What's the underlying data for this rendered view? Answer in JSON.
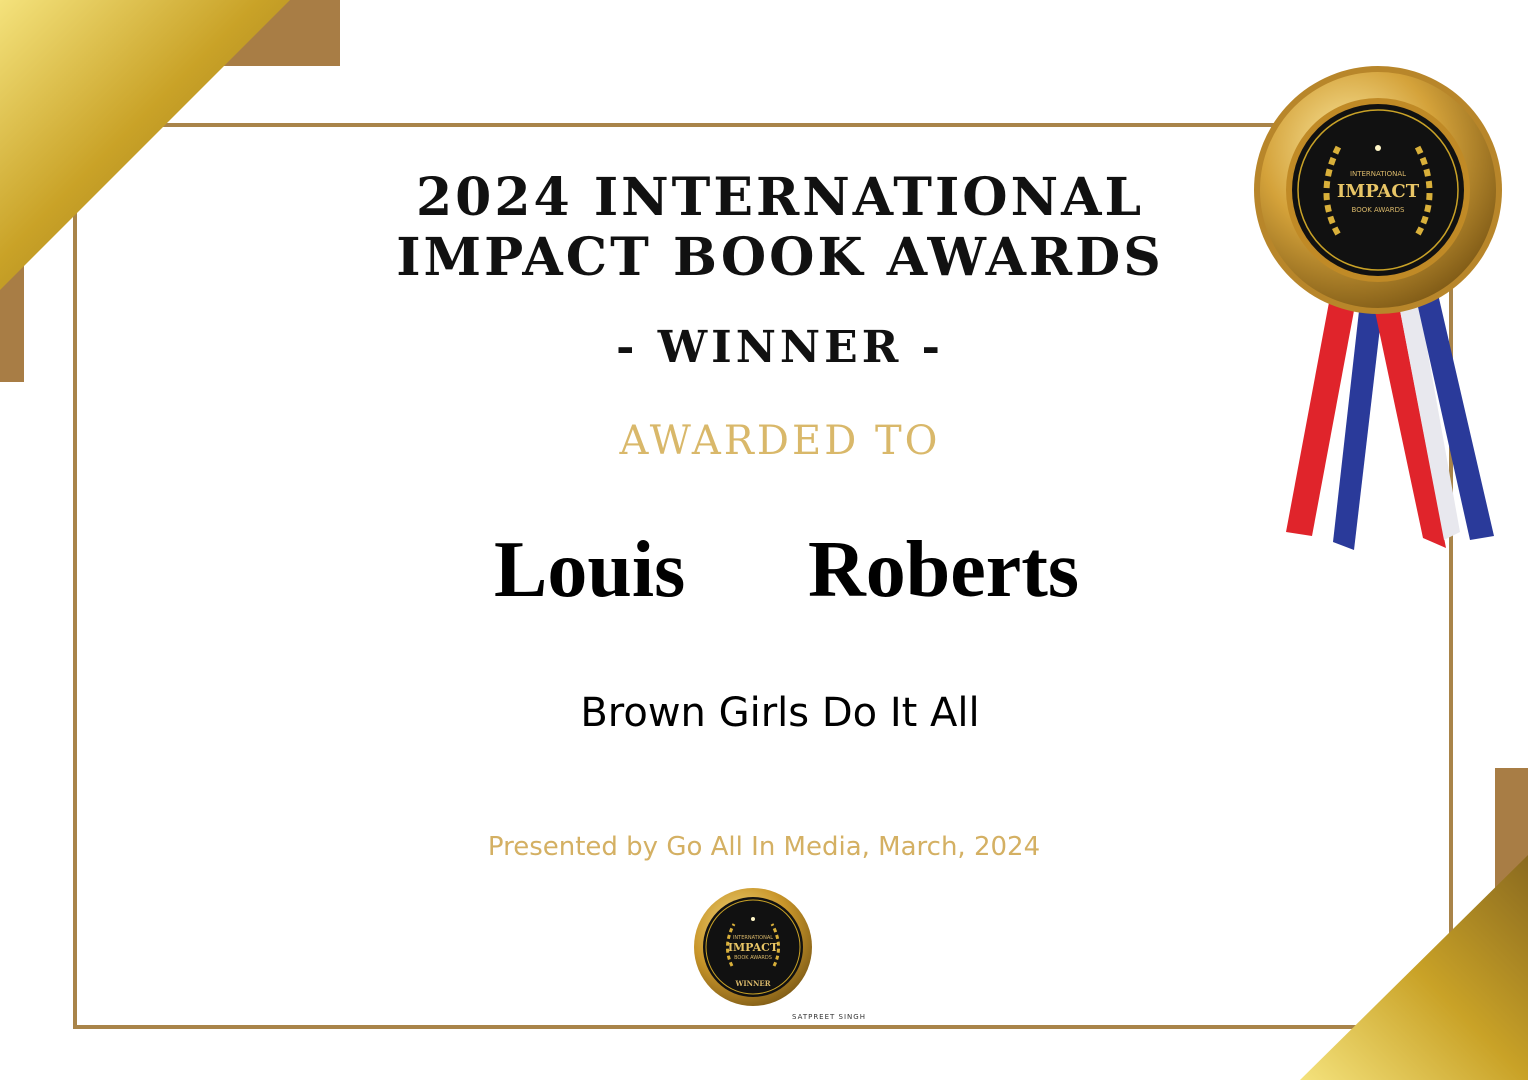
{
  "certificate": {
    "year": "2024",
    "title_line1_rest": "INTERNATIONAL",
    "title_line2": "IMPACT BOOK AWARDS",
    "winner": "- WINNER -",
    "awarded_to": "AWARDED TO",
    "first_name": "Louis",
    "last_name": "Roberts",
    "book_title": "Brown Girls Do It All",
    "presented_by": "Presented by Go All In Media, March, 2024",
    "signature": "SATPREET SINGH"
  },
  "seal": {
    "top": "INTERNATIONAL",
    "middle": "IMPACT",
    "bottom": "BOOK AWARDS",
    "small_label": "WINNER"
  },
  "colors": {
    "gold": "#c9a227",
    "bronze": "#a98449",
    "accent_text": "#d9b86a",
    "ribbon_red": "#e0242b",
    "ribbon_blue": "#2a3a9a"
  }
}
